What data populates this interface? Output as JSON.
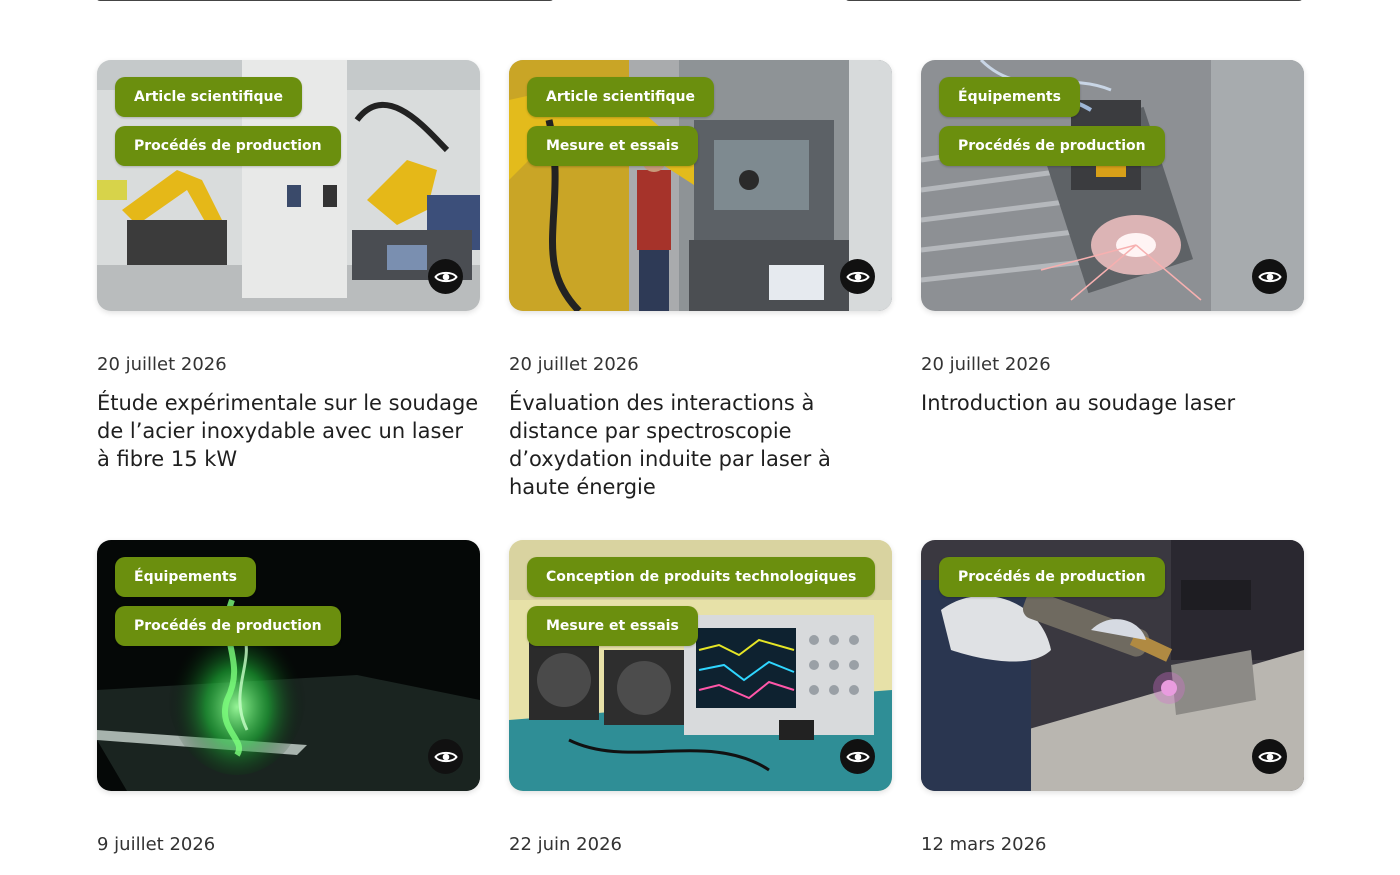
{
  "cards": [
    {
      "tags": [
        "Article scientifique",
        "Procédés de production"
      ],
      "date": "20 juillet 2026",
      "title": "Étude expérimentale sur le soudage de l’acier inoxydable avec un laser à fibre 15 kW"
    },
    {
      "tags": [
        "Article scientifique",
        "Mesure et essais"
      ],
      "date": "20 juillet 2026",
      "title": "Évaluation des interactions à distance par spectroscopie d’oxydation induite par laser à haute énergie"
    },
    {
      "tags": [
        "Équipements",
        "Procédés de production"
      ],
      "date": "20 juillet 2026",
      "title": "Introduction au soudage laser"
    },
    {
      "tags": [
        "Équipements",
        "Procédés de production"
      ],
      "date": "9 juillet 2026",
      "title": ""
    },
    {
      "tags": [
        "Conception de produits technologiques",
        "Mesure et essais"
      ],
      "date": "22 juin 2026",
      "title": ""
    },
    {
      "tags": [
        "Procédés de production"
      ],
      "date": "12 mars 2026",
      "title": ""
    }
  ],
  "icons": {
    "view": "eye-icon"
  },
  "colors": {
    "tag_bg": "#6b8f0e",
    "tag_text": "#ffffff",
    "view_button_bg": "#111111"
  }
}
